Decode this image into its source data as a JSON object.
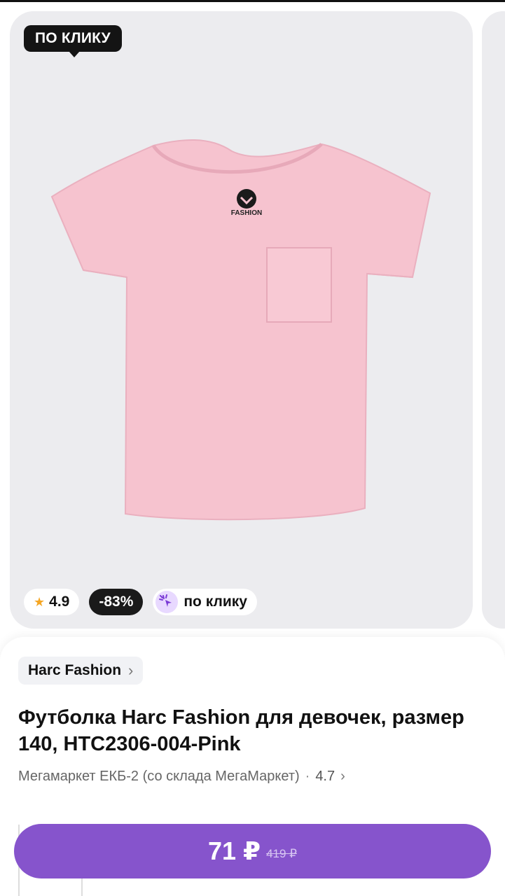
{
  "gallery": {
    "tag_top": "ПО КЛИКУ",
    "image_icon": "tshirt-image",
    "shirt_color": "#f6c3cf",
    "rating": "4.9",
    "discount": "-83%",
    "click_label": "по клику"
  },
  "product": {
    "brand": "Harc Fashion",
    "title": "Футболка Harc Fashion для девочек, размер 140, HTC2306-004-Pink",
    "seller": "Мегамаркет ЕКБ-2 (со склада МегаМаркет)",
    "seller_rating": "4.7"
  },
  "buy": {
    "price": "71 ₽",
    "old_price": "419 ₽",
    "accent": "#8654cc"
  },
  "colors": {
    "background_card": "#ececef",
    "dark_chip": "#141414"
  }
}
